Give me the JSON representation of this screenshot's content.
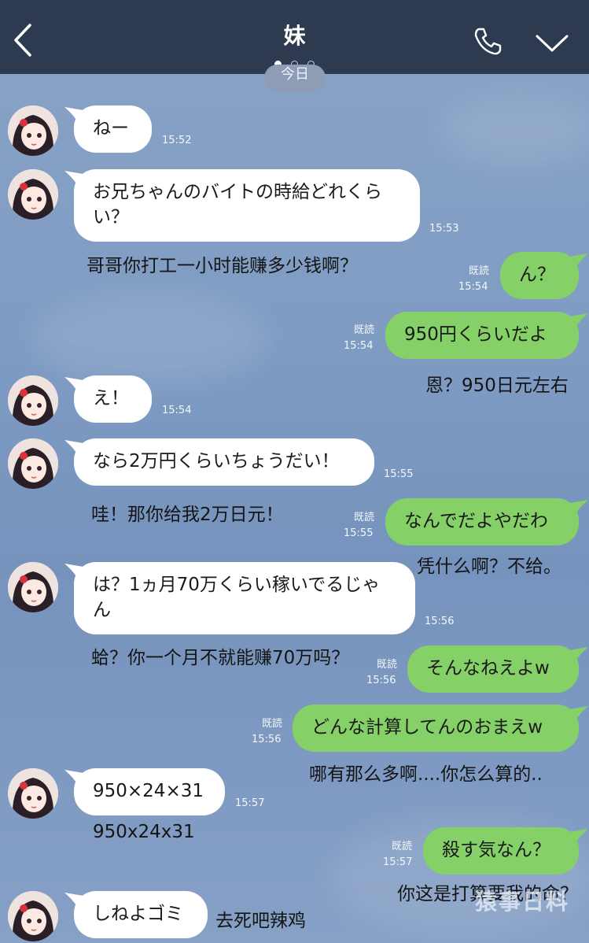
{
  "header": {
    "title": "妹",
    "page_dots": 3,
    "active_dot": 0,
    "date_pill": "今日"
  },
  "messages": [
    {
      "side": "in",
      "text": "ねー",
      "time": "15:52"
    },
    {
      "side": "in",
      "text": "お兄ちゃんのバイトの時給どれくら",
      "text2": "い？",
      "time": "15:53"
    },
    {
      "side": "out",
      "text": "ん？",
      "read": "既読",
      "time": "15:54"
    },
    {
      "side": "out",
      "text": "950円くらいだよ",
      "read": "既読",
      "time": "15:54"
    },
    {
      "side": "in",
      "text": "え！",
      "time": "15:54"
    },
    {
      "side": "in",
      "text": "なら2万円くらいちょうだい！",
      "time": "15:55"
    },
    {
      "side": "out",
      "text": "なんでだよやだわ",
      "read": "既読",
      "time": "15:55"
    },
    {
      "side": "in",
      "text": "は？1ヵ月70万くらい稼いでるじゃ",
      "text2": "ん",
      "time": "15:56"
    },
    {
      "side": "out",
      "text": "そんなねえよw",
      "read": "既読",
      "time": "15:56"
    },
    {
      "side": "out",
      "text": "どんな計算してんのおまえw",
      "read": "既読",
      "time": "15:56"
    },
    {
      "side": "in",
      "text": "950×24×31",
      "time": "15:57"
    },
    {
      "side": "out",
      "text": "殺す気なん？",
      "read": "既読",
      "time": "15:57"
    },
    {
      "side": "in",
      "text": "しねよゴミ"
    }
  ],
  "translations": [
    "哥哥你打工一小时能赚多少钱啊？",
    "恩？950日元左右",
    "哇！那你给我2万日元！",
    "凭什么啊？不给。",
    "蛤？你一个月不就能赚70万吗？",
    "哪有那么多啊....你怎么算的..",
    "950x24x31",
    "你这是打算要我的命？",
    "去死吧辣鸡"
  ],
  "watermark": "猿事日料",
  "colors": {
    "header": "#2e3a4f",
    "outgoing": "#86d068",
    "incoming": "#ffffff"
  }
}
